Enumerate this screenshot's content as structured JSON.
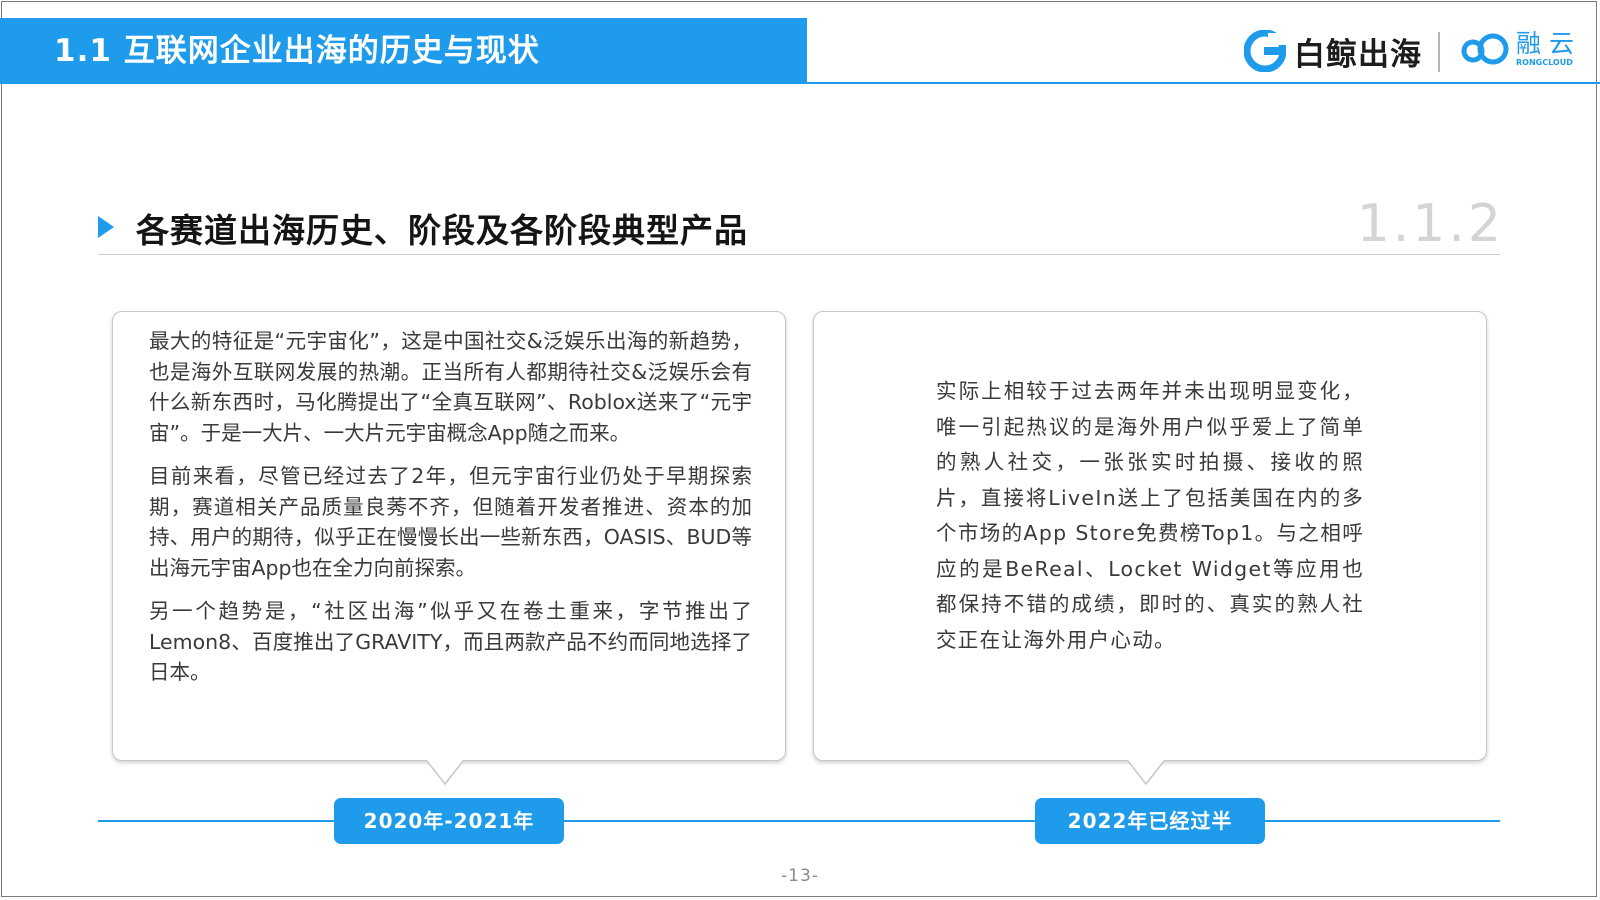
{
  "header": {
    "title": "1.1 互联网企业出海的历史与现状",
    "logo_primary": "白鲸出海",
    "logo_secondary_cn": "融云",
    "logo_secondary_en": "RONGCLOUD"
  },
  "section": {
    "title": "各赛道出海历史、阶段及各阶段典型产品",
    "number": "1.1.2"
  },
  "left_box": {
    "paragraphs": [
      "最大的特征是“元宇宙化”，这是中国社交&泛娱乐出海的新趋势，也是海外互联网发展的热潮。正当所有人都期待社交&泛娱乐会有什么新东西时，马化腾提出了“全真互联网”、Roblox送来了“元宇宙”。于是一大片、一大片元宇宙概念App随之而来。",
      "目前来看，尽管已经过去了2年，但元宇宙行业仍处于早期探索期，赛道相关产品质量良莠不齐，但随着开发者推进、资本的加持、用户的期待，似乎正在慢慢长出一些新东西，OASIS、BUD等出海元宇宙App也在全力向前探索。",
      "另一个趋势是，“社区出海”似乎又在卷土重来，字节推出了Lemon8、百度推出了GRAVITY，而且两款产品不约而同地选择了日本。"
    ]
  },
  "right_box": {
    "paragraph": "实际上相较于过去两年并未出现明显变化，唯一引起热议的是海外用户似乎爱上了简单的熟人社交，一张张实时拍摄、接收的照片，直接将LiveIn送上了包括美国在内的多个市场的App Store免费榜Top1。与之相呼应的是BeReal、Locket Widget等应用也都保持不错的成绩，即时的、真实的熟人社交正在让海外用户心动。"
  },
  "timeline": {
    "labels": [
      "2020年-2021年",
      "2022年已经过半"
    ]
  },
  "footer": {
    "page": "-13-"
  },
  "colors": {
    "accent": "#1e9bea",
    "body_text": "#3a3a3a",
    "section_number": "#d4d4d4"
  }
}
